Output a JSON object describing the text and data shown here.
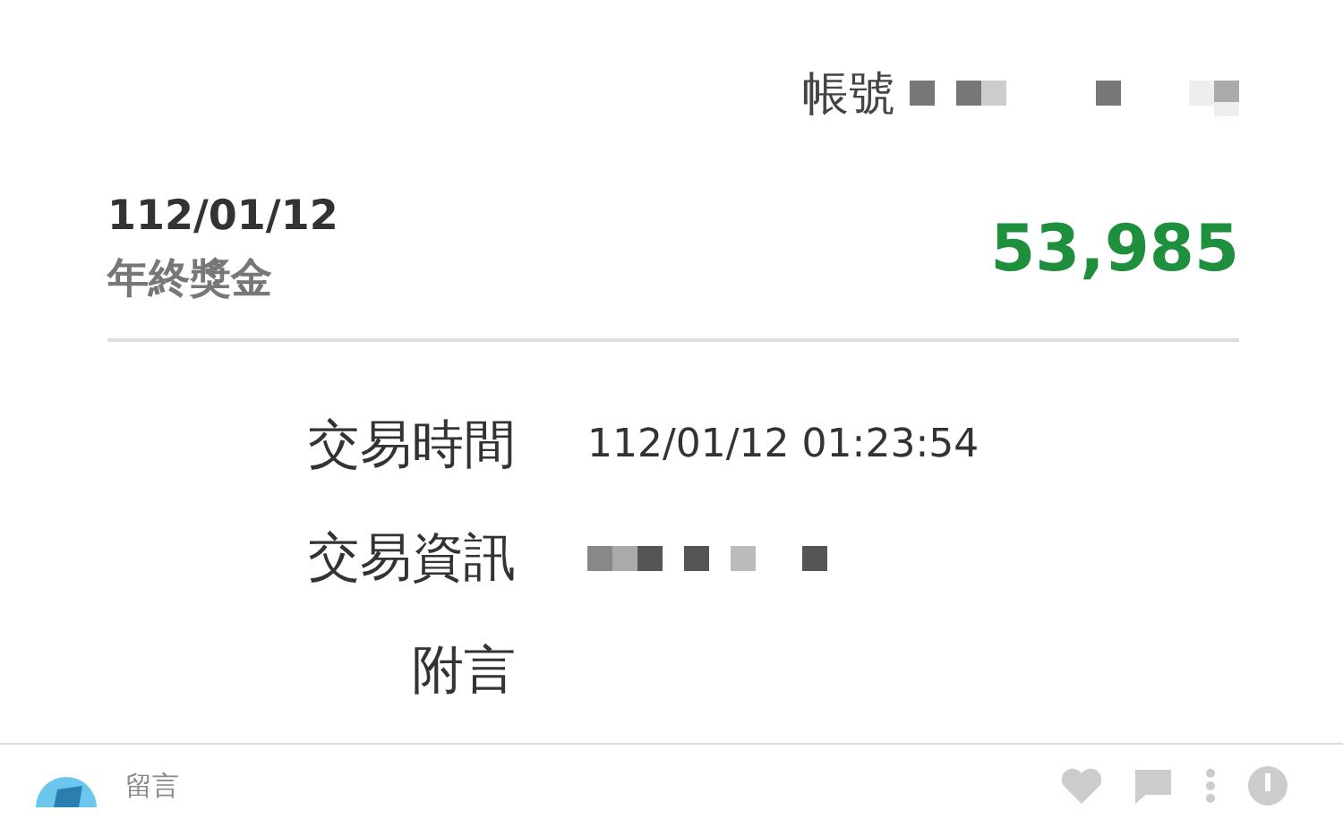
{
  "account": {
    "label": "帳號"
  },
  "transaction": {
    "date": "112/01/12",
    "description": "年終獎金",
    "amount": "53,985"
  },
  "details": [
    {
      "kind": "text",
      "label": "交易時間",
      "value": "112/01/12 01:23:54"
    },
    {
      "kind": "masked",
      "label": "交易資訊"
    },
    {
      "kind": "empty",
      "label": "附言"
    }
  ],
  "comment_bar": {
    "label": "留言"
  }
}
